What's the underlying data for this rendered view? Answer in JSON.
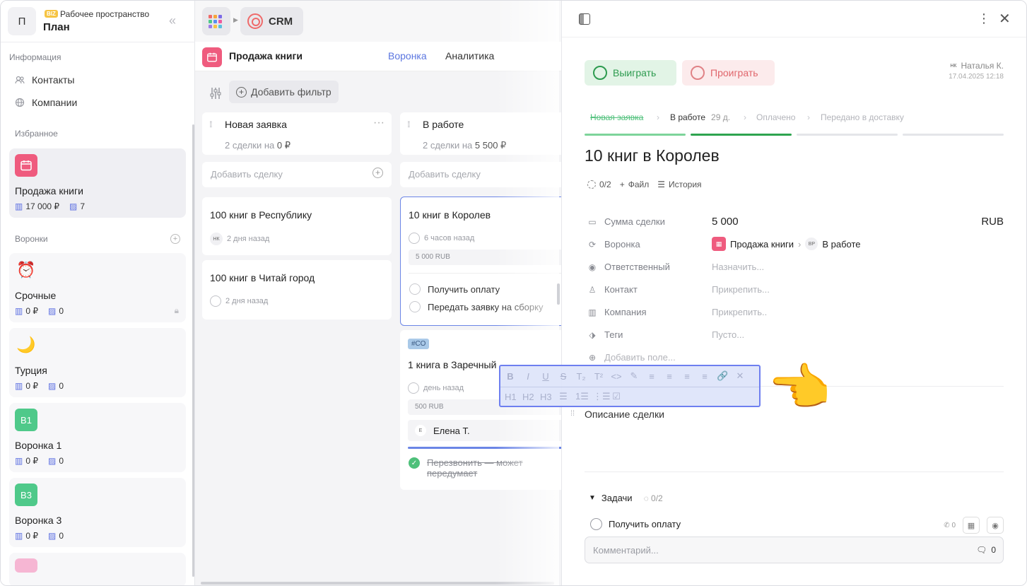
{
  "workspace": {
    "avatar": "П",
    "badge": "BIZ",
    "subtitle": "Рабочее пространство",
    "title": "План",
    "collapse_icon": "«"
  },
  "sidebar": {
    "info_label": "Информация",
    "info_items": [
      {
        "label": "Контакты",
        "icon": "contacts-icon"
      },
      {
        "label": "Компании",
        "icon": "globe-icon"
      }
    ],
    "fav_label": "Избранное",
    "fav": {
      "name": "Продажа книги",
      "amount": "17 000 ₽",
      "count": "7",
      "color": "#ef5b7e"
    },
    "funnels_label": "Воронки",
    "funnels": [
      {
        "name": "Срочные",
        "emoji": "⏰",
        "amount": "0 ₽",
        "count": "0",
        "locked": true
      },
      {
        "name": "Турция",
        "emoji": "🌙",
        "amount": "0 ₽",
        "count": "0"
      },
      {
        "name": "Воронка 1",
        "badge": "В1",
        "amount": "0 ₽",
        "count": "0",
        "color": "#4fc98a"
      },
      {
        "name": "Воронка 3",
        "badge": "В3",
        "amount": "0 ₽",
        "count": "0",
        "color": "#4fc98a"
      }
    ]
  },
  "topbar": {
    "app": "CRM"
  },
  "pipeline": {
    "title": "Продажа книги",
    "tab_funnel": "Воронка",
    "tab_analytics": "Аналитика",
    "add_filter": "Добавить фильтр"
  },
  "columns": [
    {
      "title": "Новая заявка",
      "deals_prefix": "2 сделки на",
      "deals_sum": "0 ₽",
      "add": "Добавить сделку"
    },
    {
      "title": "В работе",
      "deals_prefix": "2 сделки на",
      "deals_sum": "5 500 ₽",
      "add": "Добавить сделку"
    }
  ],
  "cards": {
    "c1": {
      "title": "100 книг в Республику",
      "avatar": "НК",
      "time": "2 дня назад"
    },
    "c2": {
      "title": "100 книг в Читай город",
      "time": "2 дня назад"
    },
    "c3": {
      "title": "10 книг в Королев",
      "time": "6 часов назад",
      "amount": "5 000 RUB",
      "task1": "Получить оплату",
      "task2": "Передать заявку на сборку"
    },
    "c4": {
      "tag": "#СО",
      "title": "1 книга в Заречный",
      "time": "день назад",
      "amount": "500 RUB",
      "person_initial": "Е",
      "person": "Елена Т.",
      "task": "Перезвонить — может передумает"
    }
  },
  "deal": {
    "win": "Выиграть",
    "lose": "Проиграть",
    "author_initials": "НК",
    "author": "Наталья К.",
    "date": "17.04.2025 12:18",
    "stages": [
      "Новая заявка",
      "В работе",
      "Оплачено",
      "Передано в доставку"
    ],
    "stage_days": "29 д.",
    "title": "10 книг в Королев",
    "progress": "0/2",
    "file": "Файл",
    "history": "История",
    "fields": {
      "sum_label": "Сумма сделки",
      "sum": "5 000",
      "currency": "RUB",
      "funnel_label": "Воронка",
      "funnel": "Продажа книги",
      "stage_initials": "ВР",
      "stage": "В работе",
      "owner_label": "Ответственный",
      "owner": "Назначить...",
      "contact_label": "Контакт",
      "contact": "Прикрепить...",
      "company_label": "Компания",
      "company": "Прикрепить..",
      "tags_label": "Теги",
      "tags": "Пусто...",
      "add_field": "Добавить поле..."
    },
    "description": "Описание сделки",
    "tasks_label": "Задачи",
    "tasks_count": "0/2",
    "task": "Получить оплату",
    "task_calls": "0",
    "comment_placeholder": "Комментарий...",
    "comment_count": "0"
  },
  "toolbar": {
    "row1": [
      "B",
      "I",
      "U",
      "S",
      "T₂",
      "T²",
      "<>",
      "✎",
      "≡",
      "≡",
      "≡",
      "≡",
      "🔗",
      "✕"
    ],
    "row2": [
      "H1",
      "H2",
      "H3",
      "☰",
      "1☰",
      "⋮☰",
      "☑"
    ]
  },
  "pointer_emoji": "👈"
}
